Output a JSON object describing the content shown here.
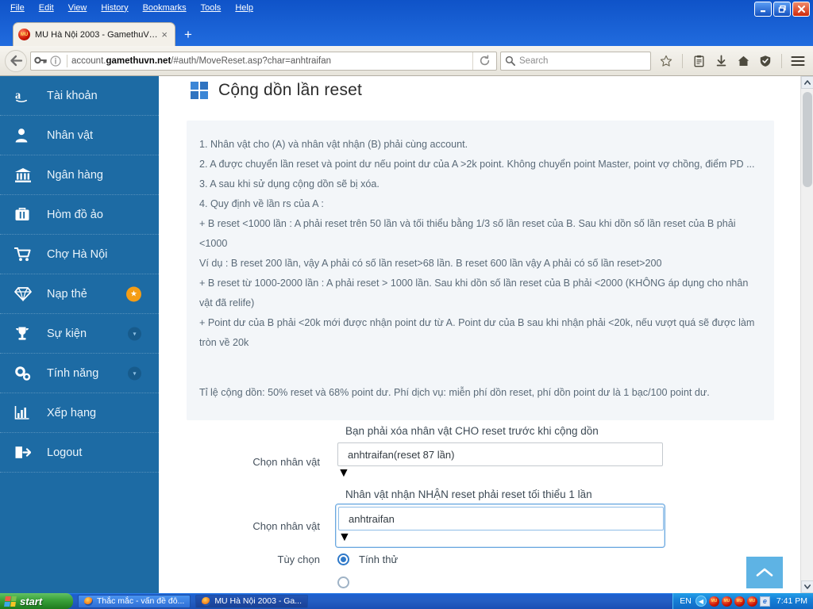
{
  "browser": {
    "menus": [
      "File",
      "Edit",
      "View",
      "History",
      "Bookmarks",
      "Tools",
      "Help"
    ],
    "window_controls": {
      "minimize": "minimize-icon",
      "restore": "restore-icon",
      "close": "close-icon"
    },
    "tab": {
      "title": "MU Hà Nội 2003 - GamethuVN...",
      "close": "×",
      "favicon": "MU"
    },
    "new_tab": "+",
    "url": {
      "host_prefix": "account.",
      "host_bold": "gamethuvn.net",
      "path": "/#auth/MoveReset.asp?char=anhtraifan"
    },
    "search_placeholder": "Search",
    "toolbar_icons": [
      "star-icon",
      "clipboard-icon",
      "download-icon",
      "home-icon",
      "shield-icon",
      "menu-icon"
    ]
  },
  "sidebar": {
    "items": [
      {
        "label": "Tài khoản",
        "icon": "amazon-a-icon",
        "badge": "none"
      },
      {
        "label": "Nhân vật",
        "icon": "user-icon",
        "badge": "none"
      },
      {
        "label": "Ngân hàng",
        "icon": "bank-icon",
        "badge": "none"
      },
      {
        "label": "Hòm đồ ảo",
        "icon": "briefcase-icon",
        "badge": "none"
      },
      {
        "label": "Chợ Hà Nội",
        "icon": "cart-icon",
        "badge": "none"
      },
      {
        "label": "Nạp thẻ",
        "icon": "diamond-icon",
        "badge": "star"
      },
      {
        "label": "Sự kiện",
        "icon": "trophy-icon",
        "badge": "chevron"
      },
      {
        "label": "Tính năng",
        "icon": "gears-icon",
        "badge": "chevron"
      },
      {
        "label": "Xếp hạng",
        "icon": "bar-chart-icon",
        "badge": "none"
      },
      {
        "label": "Logout",
        "icon": "logout-icon",
        "badge": "none"
      }
    ]
  },
  "page": {
    "title": "Cộng dồn lần reset",
    "title_icon": "windows-grid-icon",
    "rules": [
      "1. Nhân vật cho (A) và nhân vật nhận (B) phải cùng account.",
      "2. A được chuyển lần reset và point dư nếu point dư của A >2k point. Không chuyển point Master, point vợ chồng, điểm PD ... 3. A sau khi sử dụng cộng dồn sẽ bị xóa.",
      "4. Quy định về lần rs của A :",
      "+ B reset <1000 lần : A phải reset trên 50 lần và tối thiểu bằng 1/3 số lần reset của B. Sau khi dồn số lần reset của B phải <1000",
      "Ví dụ : B reset 200 lần, vậy A phải có số lần reset>68 lần. B reset 600 lần vậy A phải có số lần reset>200",
      "+ B reset từ 1000-2000 lần : A phải reset > 1000 lần. Sau khi dồn số lần reset của B phải <2000 (KHÔNG áp dụng cho nhân vật đã relife)",
      "+ Point dư của B phải <20k mới được nhận point dư từ A. Point dư của B sau khi nhận phải <20k, nếu vượt quá sẽ được làm tròn về 20k"
    ],
    "rate_note": "Tỉ lệ cộng dồn: 50% reset và 68% point dư. Phí dịch vụ: miễn phí dồn reset, phí dồn point dư là 1 bạc/100 point dư."
  },
  "form": {
    "note_give": "Bạn phải xóa nhân vật CHO reset trước khi cộng dồn",
    "note_receive": "Nhân vật nhận NHẬN reset phải reset tối thiểu 1 lần",
    "label_select_char": "Chọn nhân vật",
    "select_give_value": "anhtraifan(reset 87 lần)",
    "select_receive_value": "anhtraifan",
    "label_options": "Tùy chọn",
    "radio_try_label": "Tính thử"
  },
  "scroll_top_icon": "chevron-up-icon",
  "taskbar": {
    "start_label": "start",
    "items": [
      {
        "label": "Thắc mắc - vấn đề đô...",
        "active": false
      },
      {
        "label": "MU Hà Nội 2003 - Ga...",
        "active": true
      }
    ],
    "tray": {
      "language": "EN",
      "show_hidden": "chevron-left-icon",
      "icons": [
        "mu-icon",
        "mu-icon",
        "mu-icon",
        "mu-icon",
        "ie-icon"
      ],
      "clock": "7:41 PM"
    }
  },
  "colors": {
    "titlebar_blue": "#1861dc",
    "sidebar_blue": "#1d6ba4",
    "accent_orange": "#f49d15",
    "scrolltop_blue": "#5eb3e4",
    "radio_blue": "#2f79c9"
  }
}
